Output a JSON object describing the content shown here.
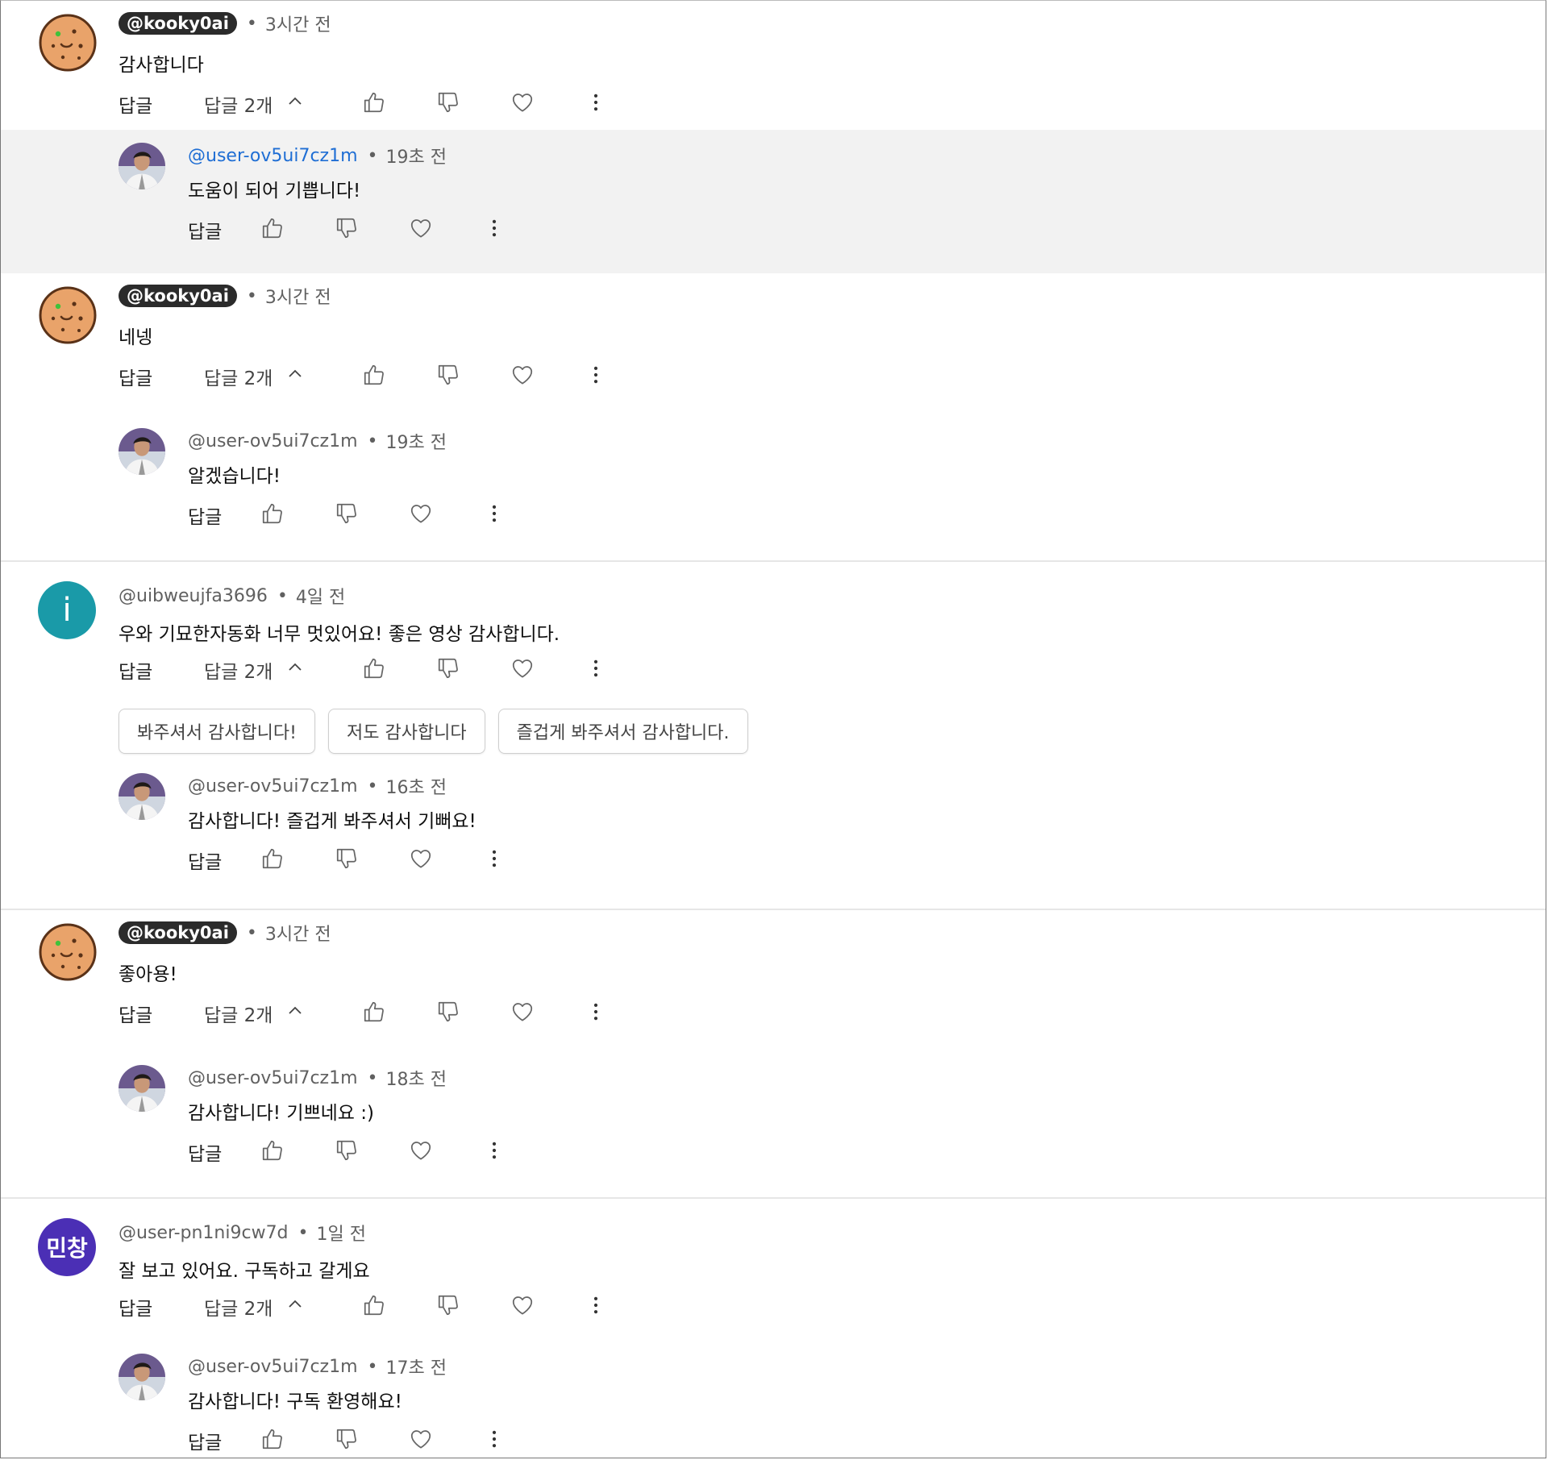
{
  "threads": [
    {
      "author": "@kooky0ai",
      "time": "3시간 전",
      "text": "감사합니다",
      "reply_label": "답글",
      "replies_label": "답글 2개",
      "reply": {
        "author": "@user-ov5ui7cz1m",
        "time": "19초 전",
        "text": "도움이 되어 기쁩니다!",
        "reply_label": "답글"
      }
    },
    {
      "author": "@kooky0ai",
      "time": "3시간 전",
      "text": "네넹",
      "reply_label": "답글",
      "replies_label": "답글 2개",
      "reply": {
        "author": "@user-ov5ui7cz1m",
        "time": "19초 전",
        "text": "알겠습니다!",
        "reply_label": "답글"
      }
    },
    {
      "author": "@uibweujfa3696",
      "avatar_letter": "i",
      "time": "4일 전",
      "text": "우와 기묘한자동화 너무 멋있어요! 좋은 영상 감사합니다.",
      "reply_label": "답글",
      "replies_label": "답글 2개",
      "suggestions": [
        "봐주셔서 감사합니다!",
        "저도 감사합니다",
        "즐겁게 봐주셔서 감사합니다."
      ],
      "reply": {
        "author": "@user-ov5ui7cz1m",
        "time": "16초 전",
        "text": "감사합니다! 즐겁게 봐주셔서 기뻐요!",
        "reply_label": "답글"
      }
    },
    {
      "author": "@kooky0ai",
      "time": "3시간 전",
      "text": "좋아용!",
      "reply_label": "답글",
      "replies_label": "답글 2개",
      "reply": {
        "author": "@user-ov5ui7cz1m",
        "time": "18초 전",
        "text": "감사합니다! 기쁘네요 :)",
        "reply_label": "답글"
      }
    },
    {
      "author": "@user-pn1ni9cw7d",
      "avatar_letter": "민창",
      "time": "1일 전",
      "text": "잘 보고 있어요. 구독하고 갈게요",
      "reply_label": "답글",
      "replies_label": "답글 2개",
      "reply": {
        "author": "@user-ov5ui7cz1m",
        "time": "17초 전",
        "text": "감사합니다! 구독 환영해요!",
        "reply_label": "답글"
      }
    }
  ],
  "dot": "•",
  "colors": {
    "link": "#1f6ed4",
    "owner_badge": "#2b2b2b",
    "teal_avatar": "#1a9aa8",
    "purple_avatar": "#4b2fb5"
  }
}
